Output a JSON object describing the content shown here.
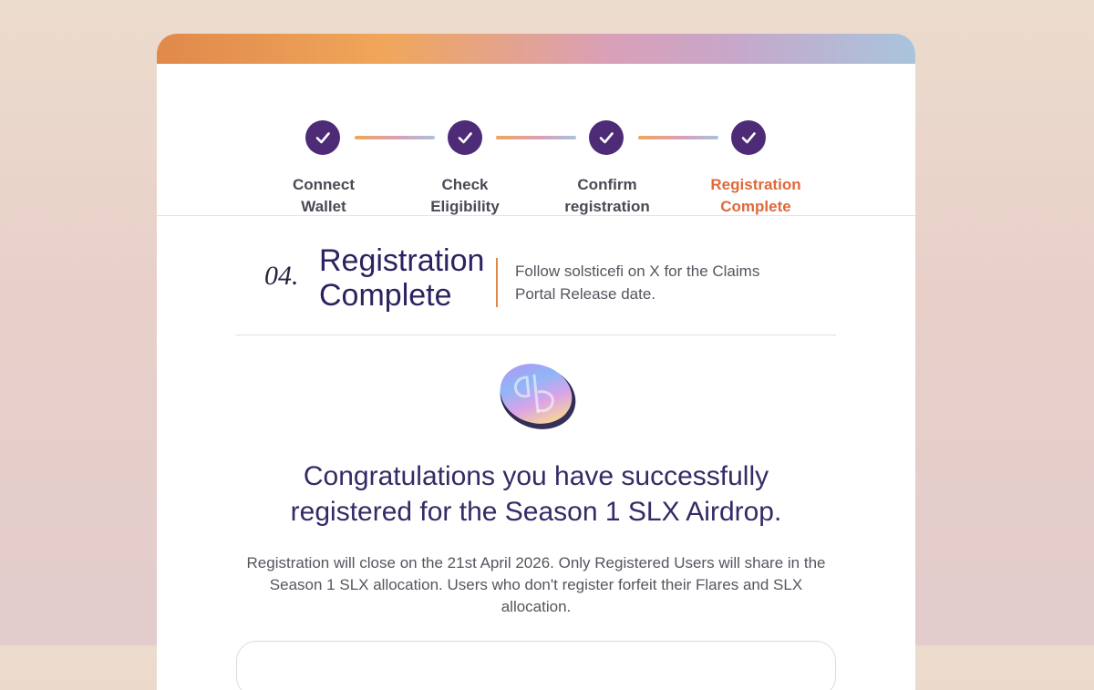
{
  "stepper": {
    "steps": [
      {
        "line1": "Connect",
        "line2": "Wallet",
        "state": "done"
      },
      {
        "line1": "Check",
        "line2": "Eligibility",
        "state": "done"
      },
      {
        "line1": "Confirm",
        "line2": "registration",
        "state": "done"
      },
      {
        "line1": "Registration",
        "line2": "Complete",
        "state": "active"
      }
    ],
    "icon": "check-icon"
  },
  "section": {
    "number": "04.",
    "title_line1": "Registration",
    "title_line2": "Complete",
    "note": "Follow solsticefi on X for the Claims Portal Release date."
  },
  "coin": {
    "icon": "slx-coin-logo"
  },
  "message": {
    "heading": "Congratulations you have successfully registered for the Season 1 SLX Airdrop.",
    "body": "Registration will close on the 21st April 2026. Only Registered Users will share in the Season 1 SLX allocation. Users who don't register forfeit their Flares and SLX allocation."
  },
  "colors": {
    "step_done": "#4e2b77",
    "step_active_label": "#e0683a",
    "heading": "#362a66",
    "accent": "#e0894b"
  }
}
